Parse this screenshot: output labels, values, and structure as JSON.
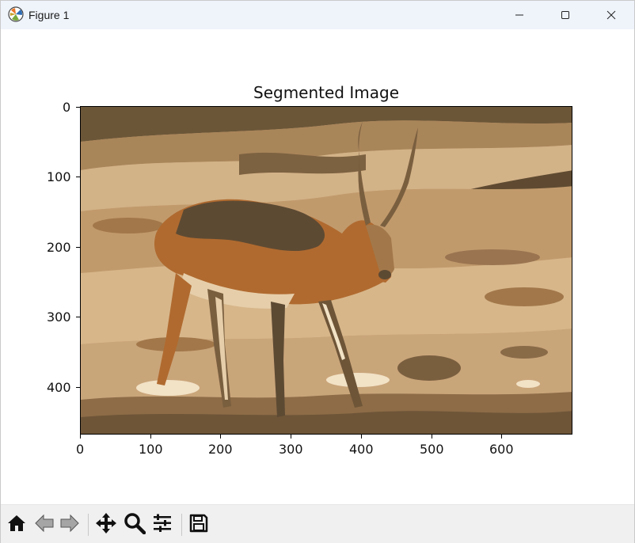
{
  "window": {
    "title": "Figure 1",
    "icons": {
      "app": "matplotlib-figure-icon",
      "minimize": "minimize-icon",
      "maximize": "maximize-icon",
      "close": "close-icon"
    }
  },
  "figure": {
    "axes_title": "Segmented Image",
    "x_ticks": [
      "0",
      "100",
      "200",
      "300",
      "400",
      "500",
      "600"
    ],
    "y_ticks": [
      "0",
      "100",
      "200",
      "300",
      "400"
    ],
    "image": {
      "subject": "antelope",
      "palette": [
        "#5d4a33",
        "#7a5f3f",
        "#a2784a",
        "#c19a6c",
        "#d7b68a",
        "#e6ceaa",
        "#b06a2f",
        "#f2e2c6"
      ]
    }
  },
  "toolbar": {
    "buttons": [
      {
        "name": "home-icon",
        "tooltip": "Home"
      },
      {
        "name": "back-icon",
        "tooltip": "Back"
      },
      {
        "name": "forward-icon",
        "tooltip": "Forward"
      },
      {
        "name": "pan-icon",
        "tooltip": "Pan"
      },
      {
        "name": "zoom-icon",
        "tooltip": "Zoom"
      },
      {
        "name": "configure-subplots-icon",
        "tooltip": "Subplots"
      },
      {
        "name": "save-icon",
        "tooltip": "Save"
      }
    ]
  }
}
